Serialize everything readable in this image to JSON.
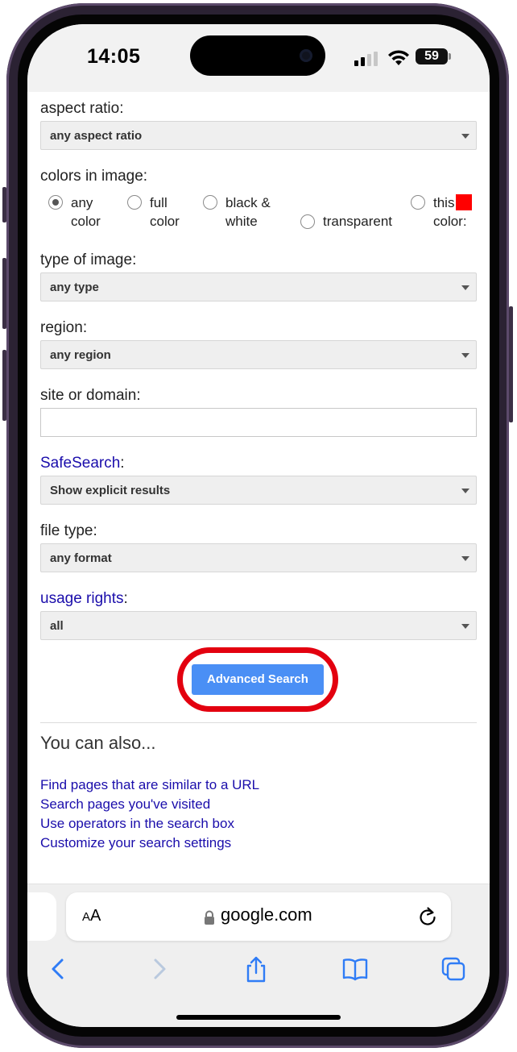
{
  "status_bar": {
    "time": "14:05",
    "battery": "59"
  },
  "form": {
    "aspect_ratio": {
      "label": "aspect ratio:",
      "value": "any aspect ratio"
    },
    "colors": {
      "label": "colors in image:",
      "options": [
        {
          "line1": "any",
          "line2": "color",
          "selected": true
        },
        {
          "line1": "full",
          "line2": "color",
          "selected": false
        },
        {
          "line1": "black &",
          "line2": "white",
          "selected": false
        },
        {
          "line1": "transparent",
          "line2": "",
          "selected": false
        },
        {
          "line1": "this",
          "line2": "color:",
          "selected": false
        }
      ],
      "swatch_color": "#ff0000"
    },
    "type_of_image": {
      "label": "type of image:",
      "value": "any type"
    },
    "region": {
      "label": "region:",
      "value": "any region"
    },
    "site_or_domain": {
      "label": "site or domain:",
      "value": ""
    },
    "safesearch": {
      "label_link": "SafeSearch",
      "label_suffix": ":",
      "value": "Show explicit results"
    },
    "file_type": {
      "label": "file type:",
      "value": "any format"
    },
    "usage_rights": {
      "label_link": "usage rights",
      "label_suffix": ":",
      "value": "all"
    },
    "submit_label": "Advanced Search"
  },
  "also": {
    "heading": "You can also...",
    "links": [
      "Find pages that are similar to a URL",
      "Search pages you've visited",
      "Use operators in the search box",
      "Customize your search settings"
    ]
  },
  "browser": {
    "text_size_label_big": "A",
    "text_size_label_small": "A",
    "domain": "google.com",
    "icons": [
      "back-icon",
      "forward-icon",
      "share-icon",
      "bookmarks-icon",
      "tabs-icon",
      "reload-icon",
      "lock-icon"
    ]
  },
  "colors": {
    "link": "#1a0dab",
    "button": "#4a8ff5",
    "highlight_ring": "#e3000f"
  }
}
